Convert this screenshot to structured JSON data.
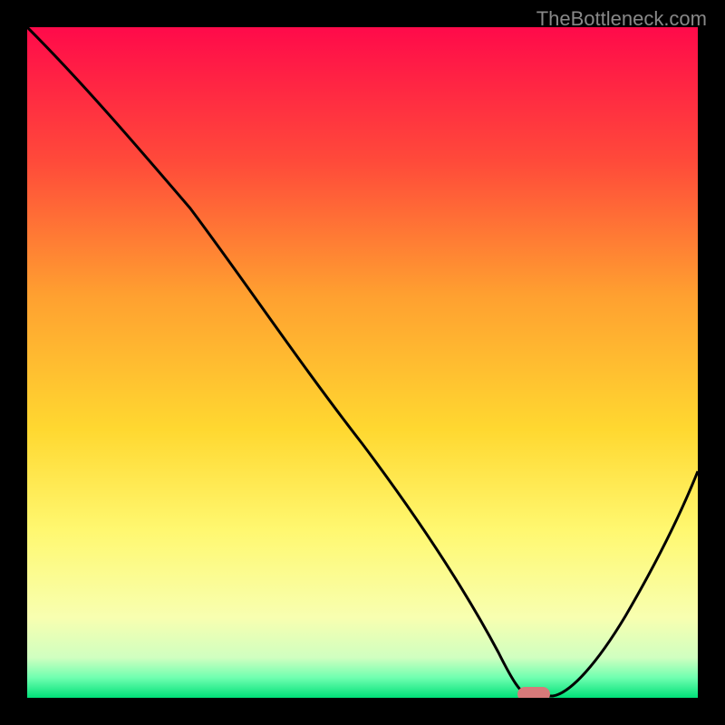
{
  "watermark": "TheBottleneck.com",
  "chart_data": {
    "type": "line",
    "title": "",
    "xlabel": "",
    "ylabel": "",
    "xlim": [
      0,
      100
    ],
    "ylim": [
      0,
      100
    ],
    "gradient_stops": [
      {
        "offset": 0,
        "color": "#ff0a4a"
      },
      {
        "offset": 20,
        "color": "#ff4a3a"
      },
      {
        "offset": 40,
        "color": "#ffa030"
      },
      {
        "offset": 60,
        "color": "#ffd830"
      },
      {
        "offset": 75,
        "color": "#fff870"
      },
      {
        "offset": 88,
        "color": "#f8ffb0"
      },
      {
        "offset": 94,
        "color": "#d0ffc0"
      },
      {
        "offset": 97,
        "color": "#70ffb0"
      },
      {
        "offset": 100,
        "color": "#00e078"
      }
    ],
    "series": [
      {
        "name": "bottleneck-curve",
        "x": [
          0,
          10,
          20,
          30,
          40,
          50,
          60,
          65,
          70,
          73,
          78,
          85,
          92,
          100
        ],
        "y": [
          100,
          90,
          78,
          66,
          53,
          40,
          27,
          18,
          8,
          1,
          0,
          8,
          20,
          35
        ]
      }
    ],
    "marker": {
      "x": 75.5,
      "y": 0
    }
  }
}
